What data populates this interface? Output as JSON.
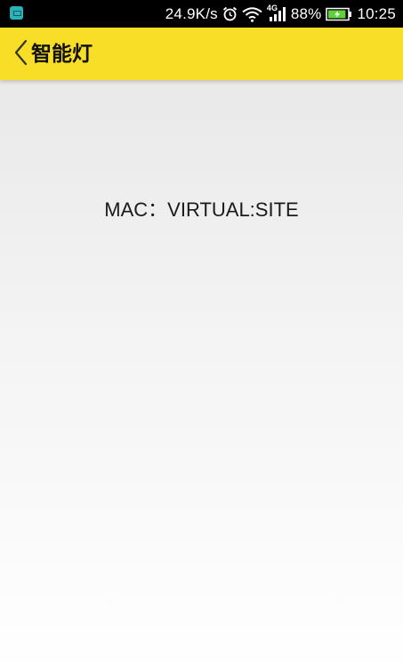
{
  "status_bar": {
    "network_speed": "24.9K/s",
    "network_type": "4G",
    "battery_percent": "88%",
    "battery_level": 0.88,
    "time": "10:25",
    "icons": [
      "app-notification-icon",
      "alarm-clock-icon",
      "wifi-icon",
      "cellular-signal-icon",
      "battery-charging-icon"
    ]
  },
  "header": {
    "title": "智能灯",
    "background_color": "#f8de26",
    "back_icon": "chevron-left-icon"
  },
  "main": {
    "mac_label": "MAC：",
    "mac_value": "VIRTUAL:SITE"
  }
}
